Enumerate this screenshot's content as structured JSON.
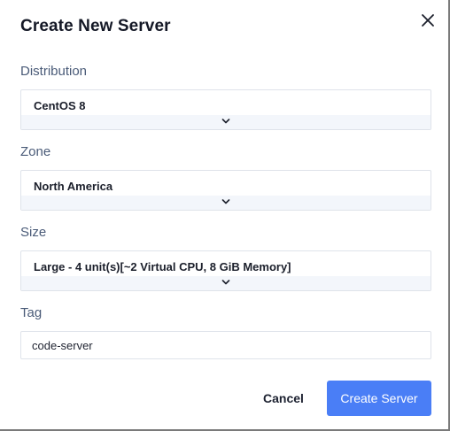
{
  "dialog": {
    "title": "Create New Server",
    "close_icon": "close-icon"
  },
  "form": {
    "distribution": {
      "label": "Distribution",
      "value": "CentOS 8"
    },
    "zone": {
      "label": "Zone",
      "value": "North America"
    },
    "size": {
      "label": "Size",
      "value": "Large - 4 unit(s)[~2 Virtual CPU, 8 GiB Memory]"
    },
    "tag": {
      "label": "Tag",
      "value": "code-server"
    }
  },
  "actions": {
    "cancel_label": "Cancel",
    "create_label": "Create Server"
  },
  "colors": {
    "primary": "#4a7ef6",
    "label": "#4a5b78",
    "border": "#dfe3ea"
  }
}
